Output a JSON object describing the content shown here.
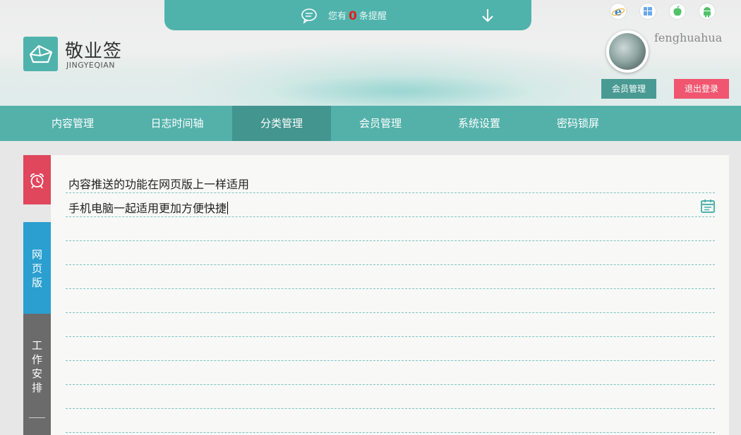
{
  "notice": {
    "prefix": "您有",
    "count": "0",
    "suffix": "条提醒"
  },
  "brand": {
    "name_cn": "敬业签",
    "name_en": "JINGYEQIAN"
  },
  "platforms": [
    {
      "name": "ie-icon",
      "color": "#3a7fd5"
    },
    {
      "name": "windows-icon",
      "color": "#5aa0e0"
    },
    {
      "name": "apple-icon",
      "color": "#52c26a"
    },
    {
      "name": "android-icon",
      "color": "#52c26a"
    }
  ],
  "user": {
    "name": "fenghuahua"
  },
  "buttons": {
    "member": "会员管理",
    "logout": "退出登录"
  },
  "nav": [
    {
      "label": "内容管理",
      "active": false
    },
    {
      "label": "日志时间轴",
      "active": false
    },
    {
      "label": "分类管理",
      "active": true
    },
    {
      "label": "会员管理",
      "active": false
    },
    {
      "label": "系统设置",
      "active": false
    },
    {
      "label": "密码锁屏",
      "active": false
    }
  ],
  "sidetabs": {
    "web": "网页版",
    "work": "工作安排"
  },
  "notes": [
    "内容推送的功能在网页版上一样适用",
    "手机电脑一起适用更加方便快捷"
  ],
  "colors": {
    "accent": "#53b1aa",
    "active_nav": "#43958f",
    "logout": "#f0566f",
    "alarm": "#e0465c",
    "web": "#2a9fd0",
    "work": "#6b6b6b"
  }
}
